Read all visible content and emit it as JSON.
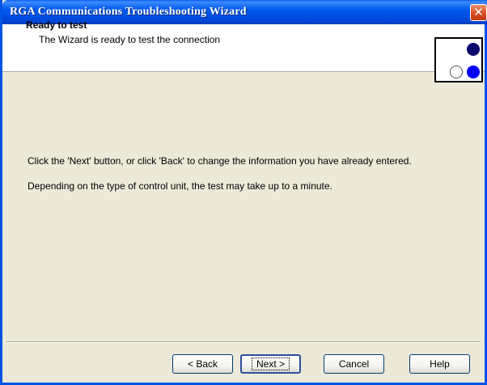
{
  "window": {
    "title": "RGA Communications Troubleshooting Wizard",
    "close_symbol": "✕"
  },
  "header": {
    "title": "Ready to test",
    "subtitle": "The Wizard is ready to test the connection",
    "logo_icon": "three-dots-logo-icon"
  },
  "body": {
    "line1": "Click the 'Next' button, or click 'Back' to change the information you have already entered.",
    "line2": "Depending on the type of control unit, the test may take up to a minute."
  },
  "buttons": {
    "back": "< Back",
    "next": "Next >",
    "cancel": "Cancel",
    "help": "Help"
  },
  "colors": {
    "titlebar": "#0054e3",
    "dialog_bg": "#ece9d8",
    "logo_dot_navy": "#0a0a6e",
    "logo_dot_blue": "#0000ff"
  }
}
